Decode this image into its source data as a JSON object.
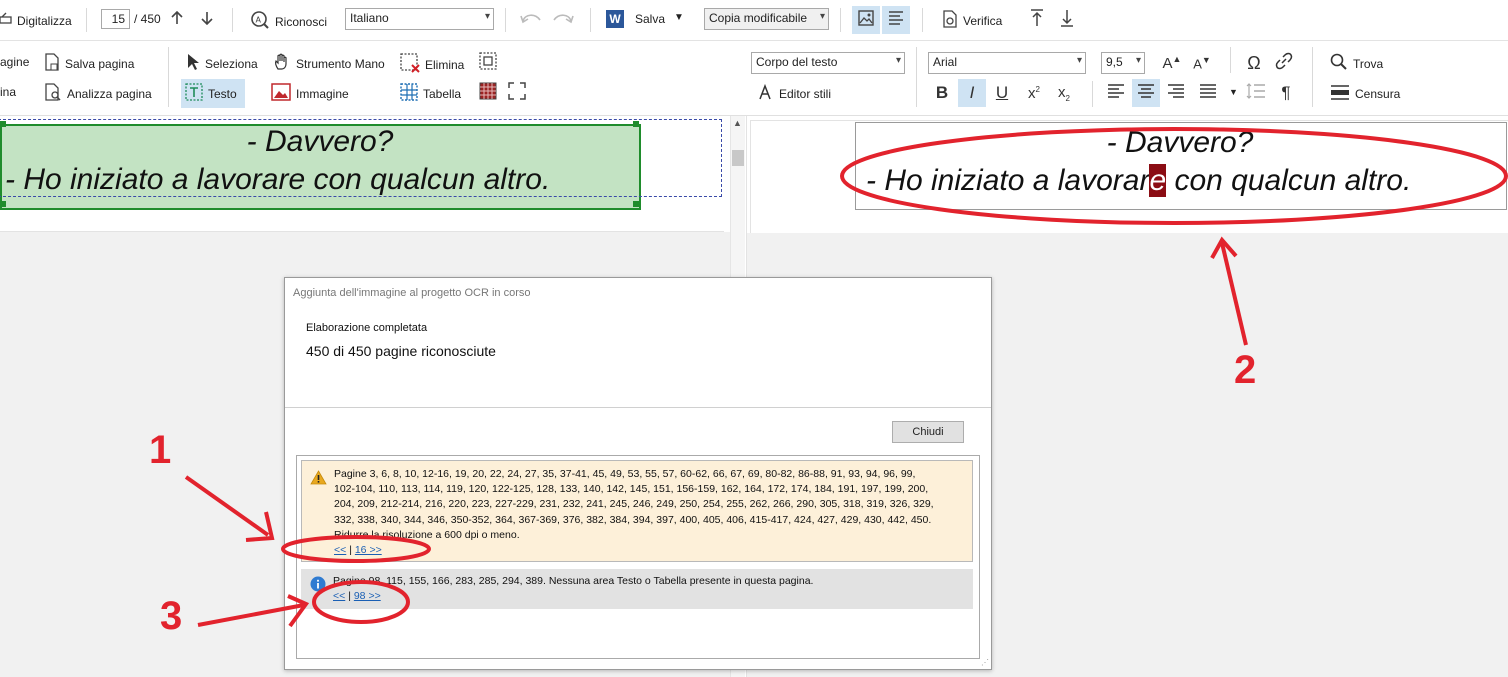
{
  "toolbar": {
    "scan_label": "Digitalizza",
    "page_current": "15",
    "page_total": "/ 450",
    "recognize_label": "Riconosci",
    "language_value": "Italiano",
    "save_label": "Salva",
    "save_mode_value": "Copia modificabile",
    "verify_label": "Verifica"
  },
  "image_tools": {
    "pages_partial": "agine",
    "pages_partial2": "ina",
    "save_page": "Salva pagina",
    "analyze_page": "Analizza pagina",
    "select": "Seleziona",
    "hand_tool": "Strumento Mano",
    "delete": "Elimina",
    "text": "Testo",
    "image": "Immagine",
    "table": "Tabella"
  },
  "text_tools": {
    "style_value": "Corpo del testo",
    "font_value": "Arial",
    "size_value": "9,5",
    "style_editor": "Editor stili",
    "find": "Trova",
    "redact": "Censura"
  },
  "image_pane": {
    "line1": "- Davvero?",
    "line2": "- Ho iniziato a lavorare con qualcun altro."
  },
  "text_pane": {
    "line1": "- Davvero?",
    "line2_before": "- Ho iniziato a lavorar",
    "line2_highlight": "e",
    "line2_after": " con qualcun altro."
  },
  "dialog": {
    "title": "Aggiunta dell'immagine al progetto OCR in corso",
    "status": "Elaborazione completata",
    "pages_recognized": "450 di 450 pagine riconosciute",
    "close_button": "Chiudi",
    "warning": {
      "lines": [
        "Pagine 3, 6, 8, 10, 12-16, 19, 20, 22, 24, 27, 35, 37-41, 45, 49, 53, 55, 57, 60-62, 66, 67, 69, 80-82, 86-88, 91, 93, 94, 96, 99,",
        "102-104, 110, 113, 114, 119, 120, 122-125, 128, 133, 140, 142, 145, 151, 156-159, 162, 164, 172, 174, 184, 191, 197, 199, 200,",
        "204, 209, 212-214, 216, 220, 223, 227-229, 231, 232, 241, 245, 246, 249, 250, 254, 255, 262, 266, 290, 305, 318, 319, 326, 329,",
        "332, 338, 340, 344, 346, 350-352, 364, 367-369, 376, 382, 384, 394, 397, 400, 405, 406, 415-417, 424, 427, 429, 430, 442, 450.",
        "Ridurre la risoluzione a 600 dpi o meno."
      ],
      "nav_prev": "<<",
      "nav_sep": "|",
      "nav_next": "16 >>"
    },
    "info": {
      "text": "Pagine 98, 115, 155, 166, 283, 285, 294, 389. Nessuna area Testo o Tabella presente in questa pagina.",
      "nav_prev": "<<",
      "nav_sep": "|",
      "nav_next": "98 >>"
    }
  },
  "annotations": {
    "label_1": "1",
    "label_2": "2",
    "label_3": "3",
    "color": "#e2232d"
  }
}
